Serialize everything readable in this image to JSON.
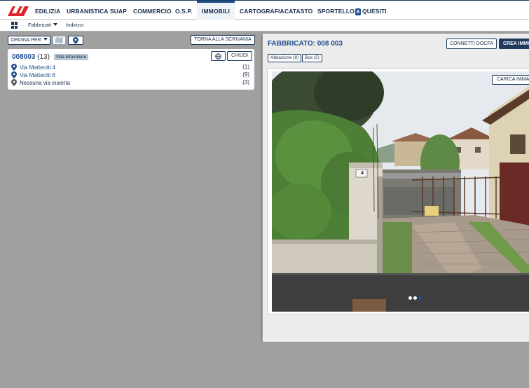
{
  "colors": {
    "brand_red": "#e0232c",
    "primary": "#1e4e8c",
    "navy": "#1a2f4d"
  },
  "nav": {
    "items": [
      {
        "id": "edilizia",
        "label": "EDILIZIA"
      },
      {
        "id": "urbanistica",
        "label": "URBANISTICA"
      },
      {
        "id": "suap",
        "label": "SUAP"
      },
      {
        "id": "commercio",
        "label": "COMMERCIO"
      },
      {
        "id": "osp",
        "label": "O.S.P."
      },
      {
        "id": "immobili",
        "label": "IMMOBILI",
        "active": true
      },
      {
        "id": "cartografia",
        "label": "CARTOGRAFIA"
      },
      {
        "id": "catasto",
        "label": "CATASTO"
      },
      {
        "id": "sportello",
        "label": "SPORTELLO",
        "badge": "8"
      },
      {
        "id": "quesiti",
        "label": "QUESITI"
      }
    ]
  },
  "subnav": {
    "fabbricati": "Fabbricati",
    "indirizzi": "Indirizzi"
  },
  "toolbar": {
    "ordina": "ORDINA PER",
    "torna": "TORNA ALLA SCRIVANIA"
  },
  "card": {
    "code": "008003",
    "count": "(13)",
    "tag": "Villa bifamiliare",
    "chiudi": "CHIUDI",
    "addresses": [
      {
        "label": "Via Matteotti 4",
        "count": "(1)"
      },
      {
        "label": "Via Matteotti 6",
        "count": "(9)"
      },
      {
        "label": "Nessuna via inserita",
        "count": "(3)"
      }
    ]
  },
  "detail": {
    "title": "FABBRICATO: 008 003",
    "connetti": "CONNETTI DOCFA",
    "crea": "CREA IMMO",
    "pills": [
      "Abitazione (8)",
      "Box (5)"
    ],
    "carica": "CARICA IMMAG",
    "photo_number": "4",
    "carousel": {
      "count": 3,
      "active": 2
    }
  }
}
